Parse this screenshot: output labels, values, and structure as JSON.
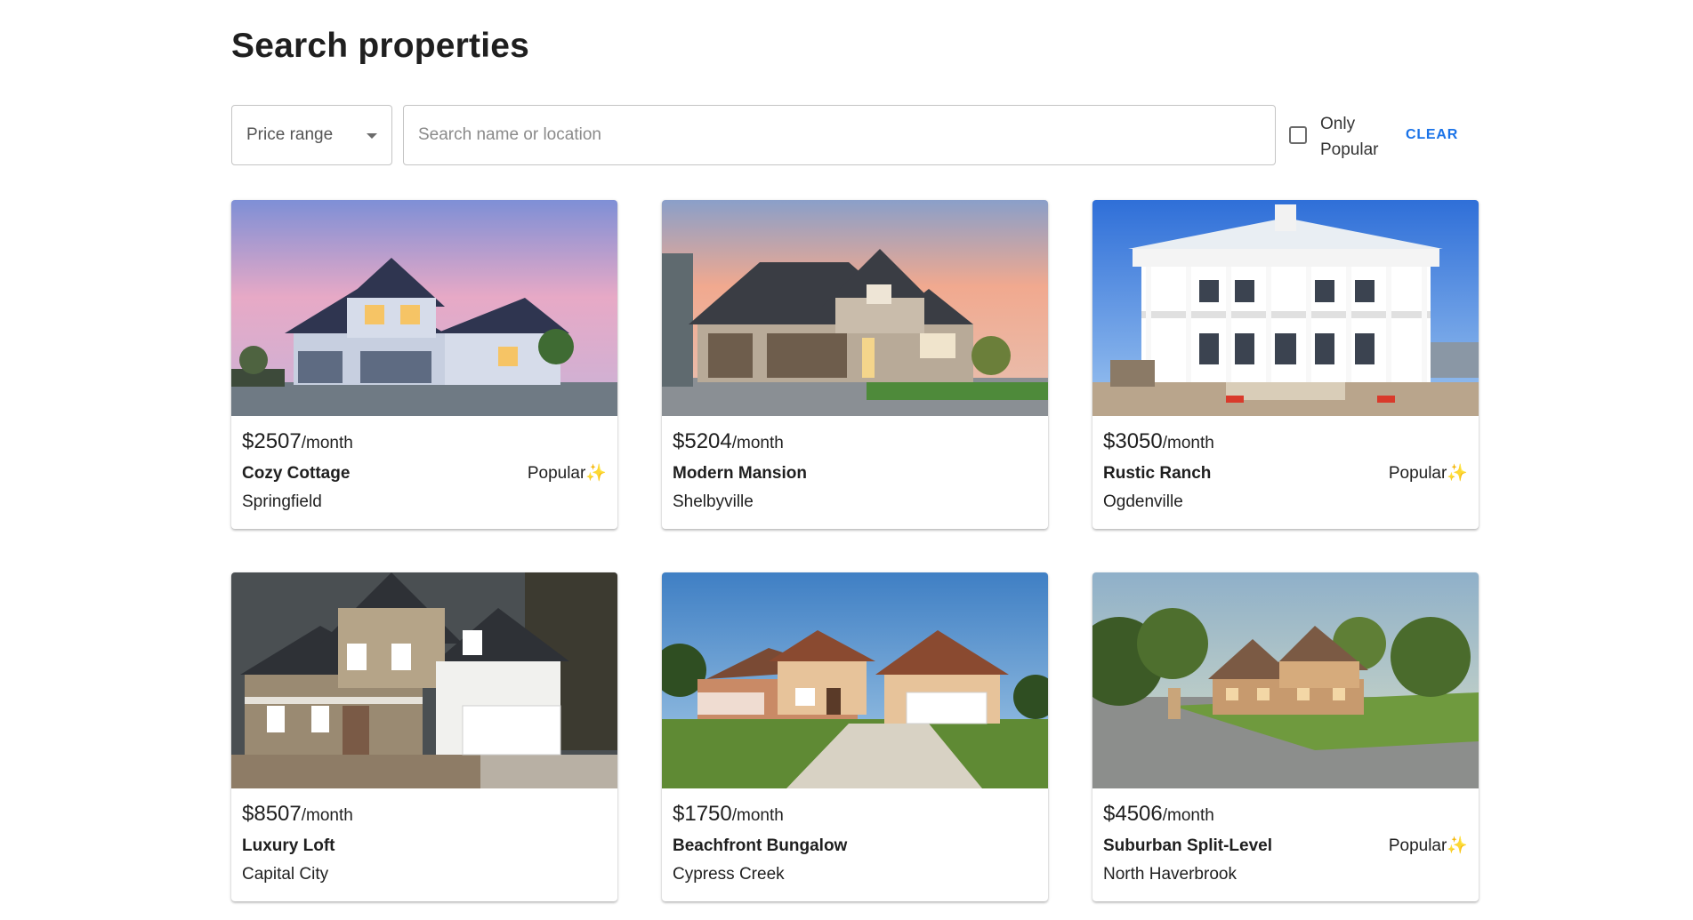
{
  "page": {
    "title": "Search properties"
  },
  "filters": {
    "price_label": "Price range",
    "search_placeholder": "Search name or location",
    "search_value": "",
    "popular_label": "Only Popular",
    "popular_checked": false,
    "clear_label": "CLEAR"
  },
  "listings": [
    {
      "price": "$2507",
      "per": "/month",
      "name": "Cozy Cottage",
      "location": "Springfield",
      "badge": "Popular",
      "badge_icon": "✨"
    },
    {
      "price": "$5204",
      "per": "/month",
      "name": "Modern Mansion",
      "location": "Shelbyville",
      "badge": "",
      "badge_icon": ""
    },
    {
      "price": "$3050",
      "per": "/month",
      "name": "Rustic Ranch",
      "location": "Ogdenville",
      "badge": "Popular",
      "badge_icon": "✨"
    },
    {
      "price": "$8507",
      "per": "/month",
      "name": "Luxury Loft",
      "location": "Capital City",
      "badge": "",
      "badge_icon": ""
    },
    {
      "price": "$1750",
      "per": "/month",
      "name": "Beachfront Bungalow",
      "location": "Cypress Creek",
      "badge": "",
      "badge_icon": ""
    },
    {
      "price": "$4506",
      "per": "/month",
      "name": "Suburban Split-Level",
      "location": "North Haverbrook",
      "badge": "Popular",
      "badge_icon": "✨"
    }
  ],
  "colors": {
    "accent": "#1a73e8",
    "sparkle": "#f5b400"
  }
}
